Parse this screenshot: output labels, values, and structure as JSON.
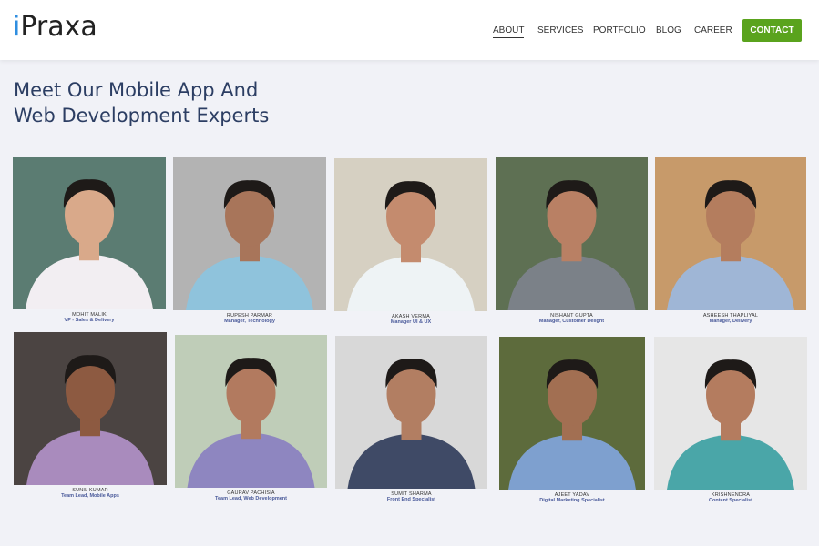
{
  "brand": {
    "logo_i": "i",
    "logo_rest": "Praxa",
    "accent": "#2f8ee0"
  },
  "nav": {
    "items": [
      "ABOUT",
      "SERVICES",
      "PORTFOLIO",
      "BLOG",
      "CAREER"
    ],
    "active": "ABOUT",
    "contact_label": "CONTACT",
    "contact_color": "#5aa31d"
  },
  "page": {
    "headline_line1": "Meet Our Mobile App And",
    "headline_line2": "Web Development Experts",
    "headline_color": "#2c3e63"
  },
  "team": [
    {
      "name": "MOHIT MALIK",
      "role": "VP - Sales & Delivery",
      "bg": "#5b7c72",
      "shirt": "#f2eef2",
      "skin": "#d9a98a"
    },
    {
      "name": "RUPESH PARMAR",
      "role": "Manager, Technology",
      "bg": "#b3b3b3",
      "shirt": "#8fc3dc",
      "skin": "#a8755a"
    },
    {
      "name": "AKASH VERMA",
      "role": "Manager UI & UX",
      "bg": "#d6d0c2",
      "shirt": "#eef3f5",
      "skin": "#c48b6e"
    },
    {
      "name": "NISHANT GUPTA",
      "role": "Manager, Customer Delight",
      "bg": "#5e7053",
      "shirt": "#7b8188",
      "skin": "#b98064"
    },
    {
      "name": "ASHEESH THAPLIYAL",
      "role": "Manager, Delivery",
      "bg": "#c79a6a",
      "shirt": "#9fb6d6",
      "skin": "#b47d5e"
    },
    {
      "name": "SUNIL KUMAR",
      "role": "Team Lead, Mobile Apps",
      "bg": "#4b4442",
      "shirt": "#a98bbd",
      "skin": "#8d5a41"
    },
    {
      "name": "GAURAV PACHISIA",
      "role": "Team Lead, Web Development",
      "bg": "#bfcdb8",
      "shirt": "#8e86c0",
      "skin": "#b27a5f"
    },
    {
      "name": "SUMIT SHARMA",
      "role": "Front End Specialist",
      "bg": "#d8d8d8",
      "shirt": "#3f4a66",
      "skin": "#b27e62"
    },
    {
      "name": "AJEET YADAV",
      "role": "Digital Marketing Specialist",
      "bg": "#5d6b3c",
      "shirt": "#7ea0cf",
      "skin": "#a26f52"
    },
    {
      "name": "KRISHNENDRA",
      "role": "Content Specialist",
      "bg": "#e6e6e6",
      "shirt": "#4aa6a8",
      "skin": "#b47c5f"
    }
  ]
}
